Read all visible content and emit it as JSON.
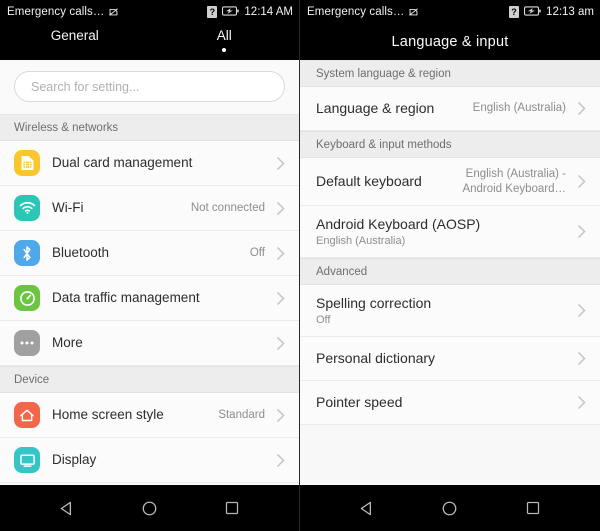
{
  "colors": {
    "sim_yellow": "#FBC531",
    "wifi_teal": "#2BC6B6",
    "bluetooth_blue": "#4FA8E8",
    "data_green": "#6CC443",
    "more_gray": "#A0A0A0",
    "home_coral": "#F4664A",
    "display_cyan": "#34C6C6",
    "statusbar_bg": "#000000",
    "list_bg": "#FBFBFB",
    "section_bg": "#EDEDED"
  },
  "left": {
    "status": {
      "carrier": "Emergency calls…",
      "nosim_icon": "no-sim-icon",
      "question_icon": "question-badge-icon",
      "battery_icon": "battery-icon",
      "time": "12:14 AM"
    },
    "tabs": [
      {
        "label": "General",
        "selected": false
      },
      {
        "label": "All",
        "selected": true
      }
    ],
    "search": {
      "placeholder": "Search for setting...",
      "value": ""
    },
    "sections": [
      {
        "header": "Wireless & networks",
        "rows": [
          {
            "icon": "sim-card-icon",
            "label": "Dual card management",
            "value": "",
            "sublabel": "",
            "chevron": true
          },
          {
            "icon": "wifi-icon",
            "label": "Wi-Fi",
            "value": "Not connected",
            "sublabel": "",
            "chevron": true
          },
          {
            "icon": "bluetooth-icon",
            "label": "Bluetooth",
            "value": "Off",
            "sublabel": "",
            "chevron": true
          },
          {
            "icon": "speedometer-icon",
            "label": "Data traffic management",
            "value": "",
            "sublabel": "",
            "chevron": true
          },
          {
            "icon": "ellipsis-icon",
            "label": "More",
            "value": "",
            "sublabel": "",
            "chevron": true
          }
        ]
      },
      {
        "header": "Device",
        "rows": [
          {
            "icon": "home-icon",
            "label": "Home screen style",
            "value": "Standard",
            "sublabel": "",
            "chevron": true
          },
          {
            "icon": "display-icon",
            "label": "Display",
            "value": "",
            "sublabel": "",
            "chevron": true
          }
        ]
      }
    ]
  },
  "right": {
    "status": {
      "carrier": "Emergency calls…",
      "nosim_icon": "no-sim-icon",
      "question_icon": "question-badge-icon",
      "battery_icon": "battery-icon",
      "time": "12:13 am"
    },
    "title": "Language & input",
    "sections": [
      {
        "header": "System language & region",
        "rows": [
          {
            "label": "Language & region",
            "value": "English (Australia)",
            "sublabel": "",
            "chevron": true
          }
        ]
      },
      {
        "header": "Keyboard & input methods",
        "rows": [
          {
            "label": "Default keyboard",
            "value": "English (Australia) -\nAndroid Keyboard…",
            "sublabel": "",
            "chevron": true
          },
          {
            "label": "Android Keyboard (AOSP)",
            "value": "",
            "sublabel": "English (Australia)",
            "chevron": true
          }
        ]
      },
      {
        "header": "Advanced",
        "rows": [
          {
            "label": "Spelling correction",
            "value": "",
            "sublabel": "Off",
            "chevron": true
          },
          {
            "label": "Personal dictionary",
            "value": "",
            "sublabel": "",
            "chevron": true
          },
          {
            "label": "Pointer speed",
            "value": "",
            "sublabel": "",
            "chevron": true
          }
        ]
      }
    ]
  },
  "navbar": {
    "back_label": "back-button",
    "home_label": "home-button",
    "recents_label": "recents-button"
  }
}
